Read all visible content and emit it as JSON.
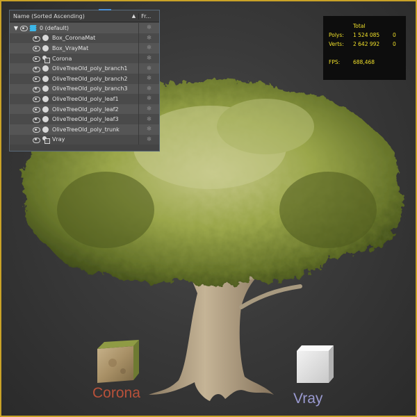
{
  "explorer": {
    "header_name": "Name (Sorted Ascending)",
    "header_freeze": "Fr...",
    "sort_indicator": "▲",
    "rows": [
      {
        "label": "0 (default)",
        "icon": "layers-icon",
        "expanded": true
      },
      {
        "label": "Box_CoronaMat",
        "icon": "object-icon"
      },
      {
        "label": "Box_VrayMat",
        "icon": "object-icon"
      },
      {
        "label": "Corona",
        "icon": "camera-icon"
      },
      {
        "label": "OliveTreeOld_poly_branch1",
        "icon": "object-icon"
      },
      {
        "label": "OliveTreeOld_poly_branch2",
        "icon": "object-icon"
      },
      {
        "label": "OliveTreeOld_poly_branch3",
        "icon": "object-icon"
      },
      {
        "label": "OliveTreeOld_poly_leaf1",
        "icon": "object-icon"
      },
      {
        "label": "OliveTreeOld_poly_leaf2",
        "icon": "object-icon"
      },
      {
        "label": "OliveTreeOld_poly_leaf3",
        "icon": "object-icon"
      },
      {
        "label": "OliveTreeOld_poly_trunk",
        "icon": "object-icon"
      },
      {
        "label": "Vray",
        "icon": "camera-icon"
      }
    ],
    "freeze_icon": "snowflake-icon"
  },
  "stats": {
    "col_header": "Total",
    "polys_label": "Polys:",
    "polys_total": "1 524 085",
    "polys_selected": "0",
    "verts_label": "Verts:",
    "verts_total": "2 642 992",
    "verts_selected": "0",
    "fps_label": "FPS:",
    "fps_value": "688,468",
    "text_color": "#f0e02a"
  },
  "scene": {
    "corona_label": "Corona",
    "vray_label": "Vray",
    "corona_color": "#b8513a",
    "vray_color": "#9a9ad0",
    "viewport_border_color": "#c9a227"
  }
}
